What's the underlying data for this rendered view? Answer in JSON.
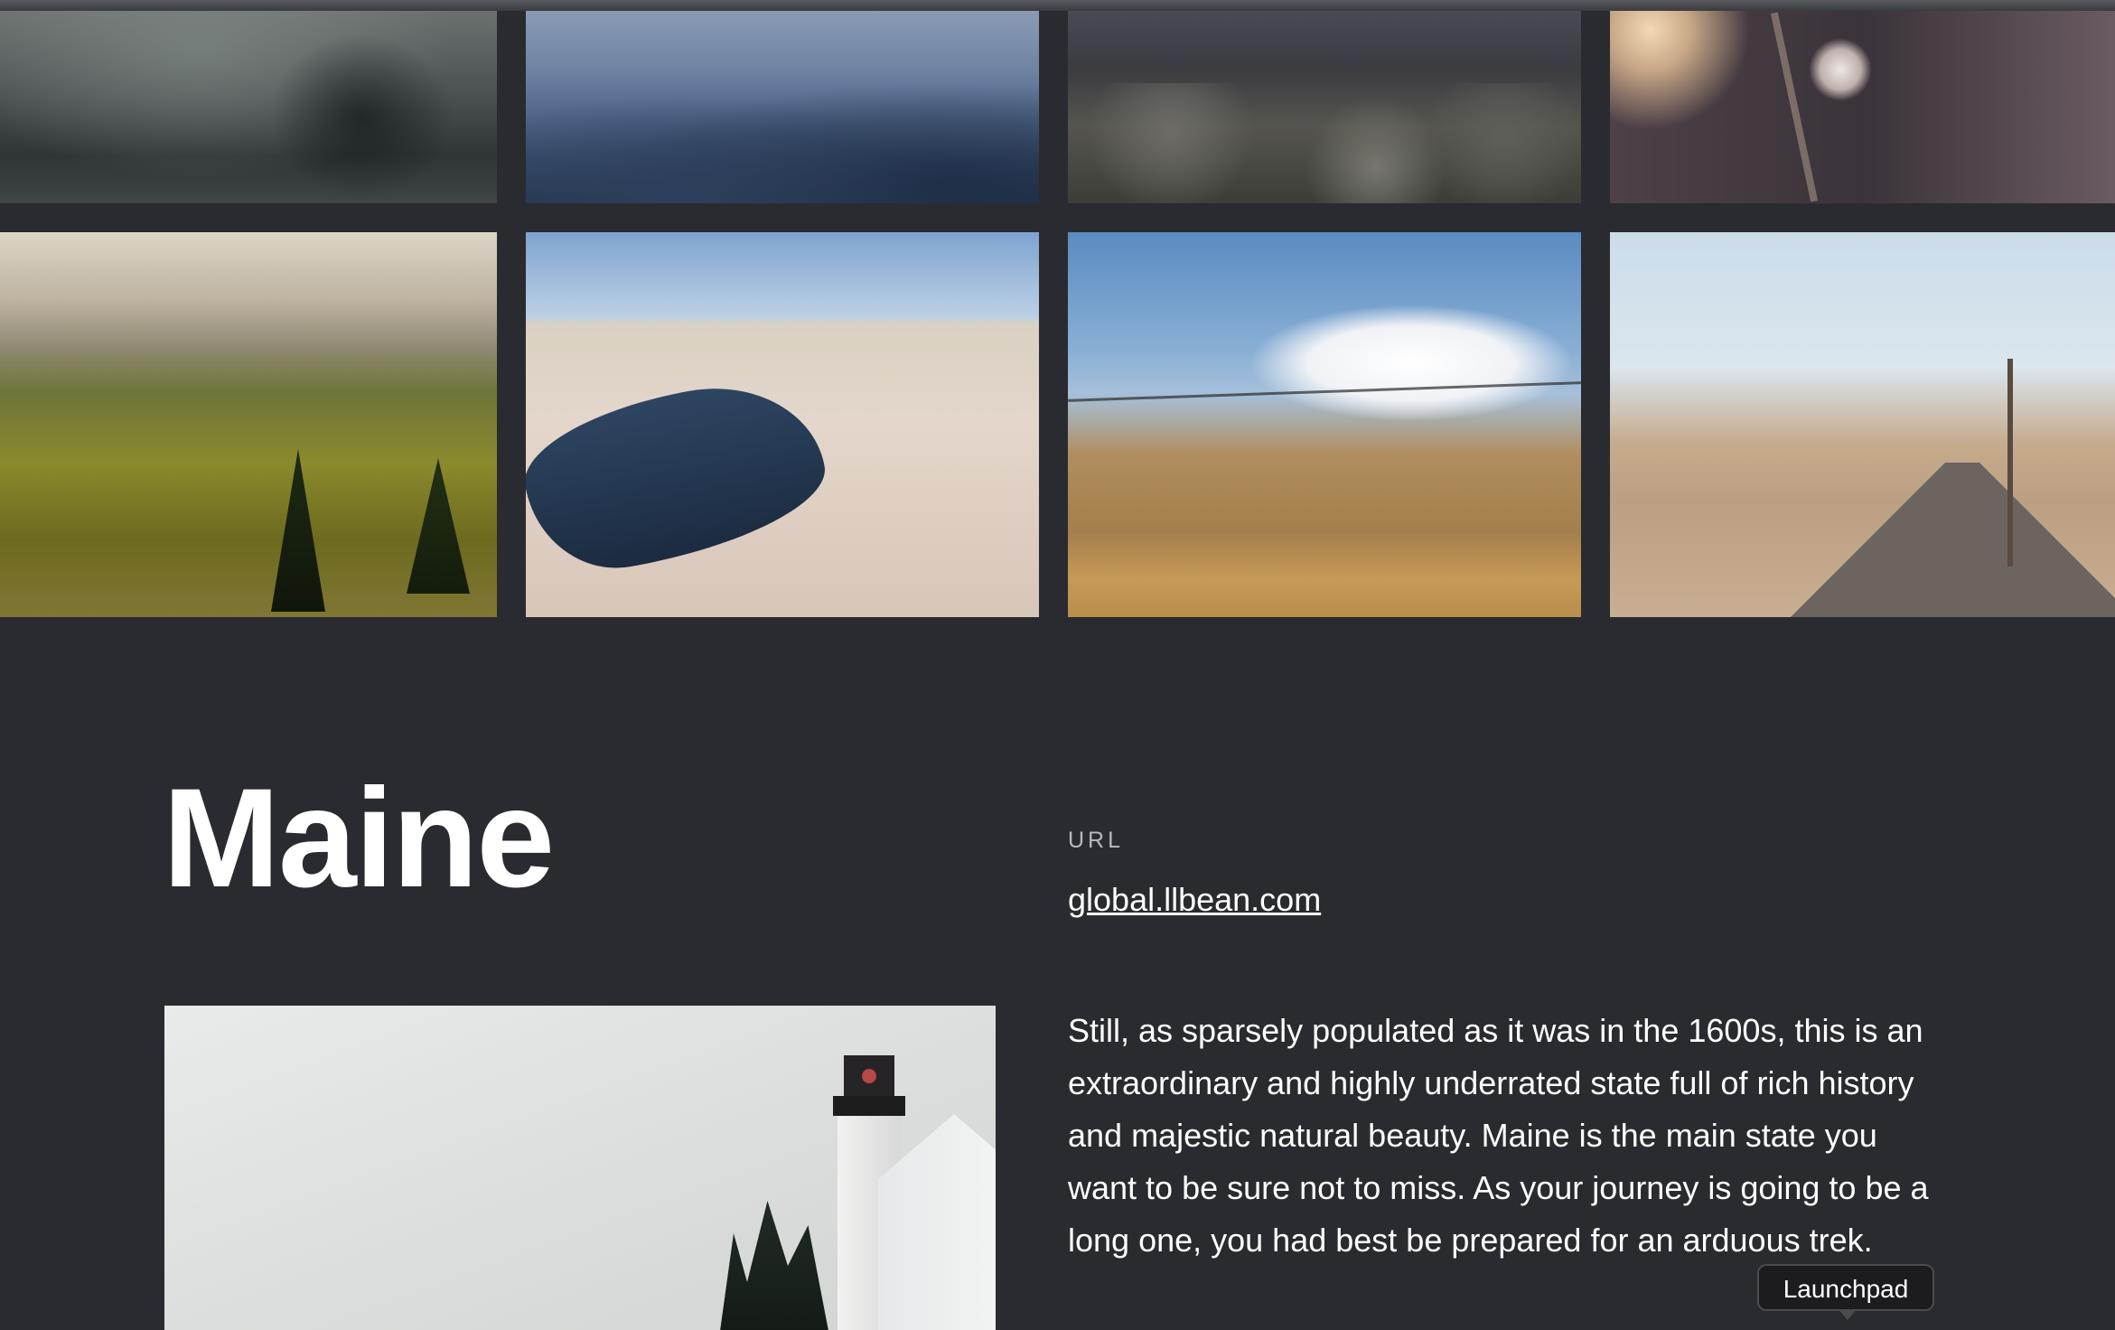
{
  "gallery": {
    "images": [
      {
        "id": "foggy-lake-image"
      },
      {
        "id": "blue-mountains-image"
      },
      {
        "id": "rocky-slope-image"
      },
      {
        "id": "dried-flower-image"
      },
      {
        "id": "green-valley-image"
      },
      {
        "id": "dunes-lake-image"
      },
      {
        "id": "birds-on-wire-image"
      },
      {
        "id": "desert-road-image"
      }
    ]
  },
  "article": {
    "title": "Maine",
    "url_label": "URL",
    "url_text": "global.llbean.com",
    "description": "Still, as sparsely populated as it was in the 1600s, this is an extraordinary and highly underrated state full of rich history and majestic natural beauty. Maine is the main state you want to be sure not to miss. As your journey is going to be a long one, you had best be prepared for an arduous trek."
  },
  "dock": {
    "tooltip": "Launchpad"
  }
}
